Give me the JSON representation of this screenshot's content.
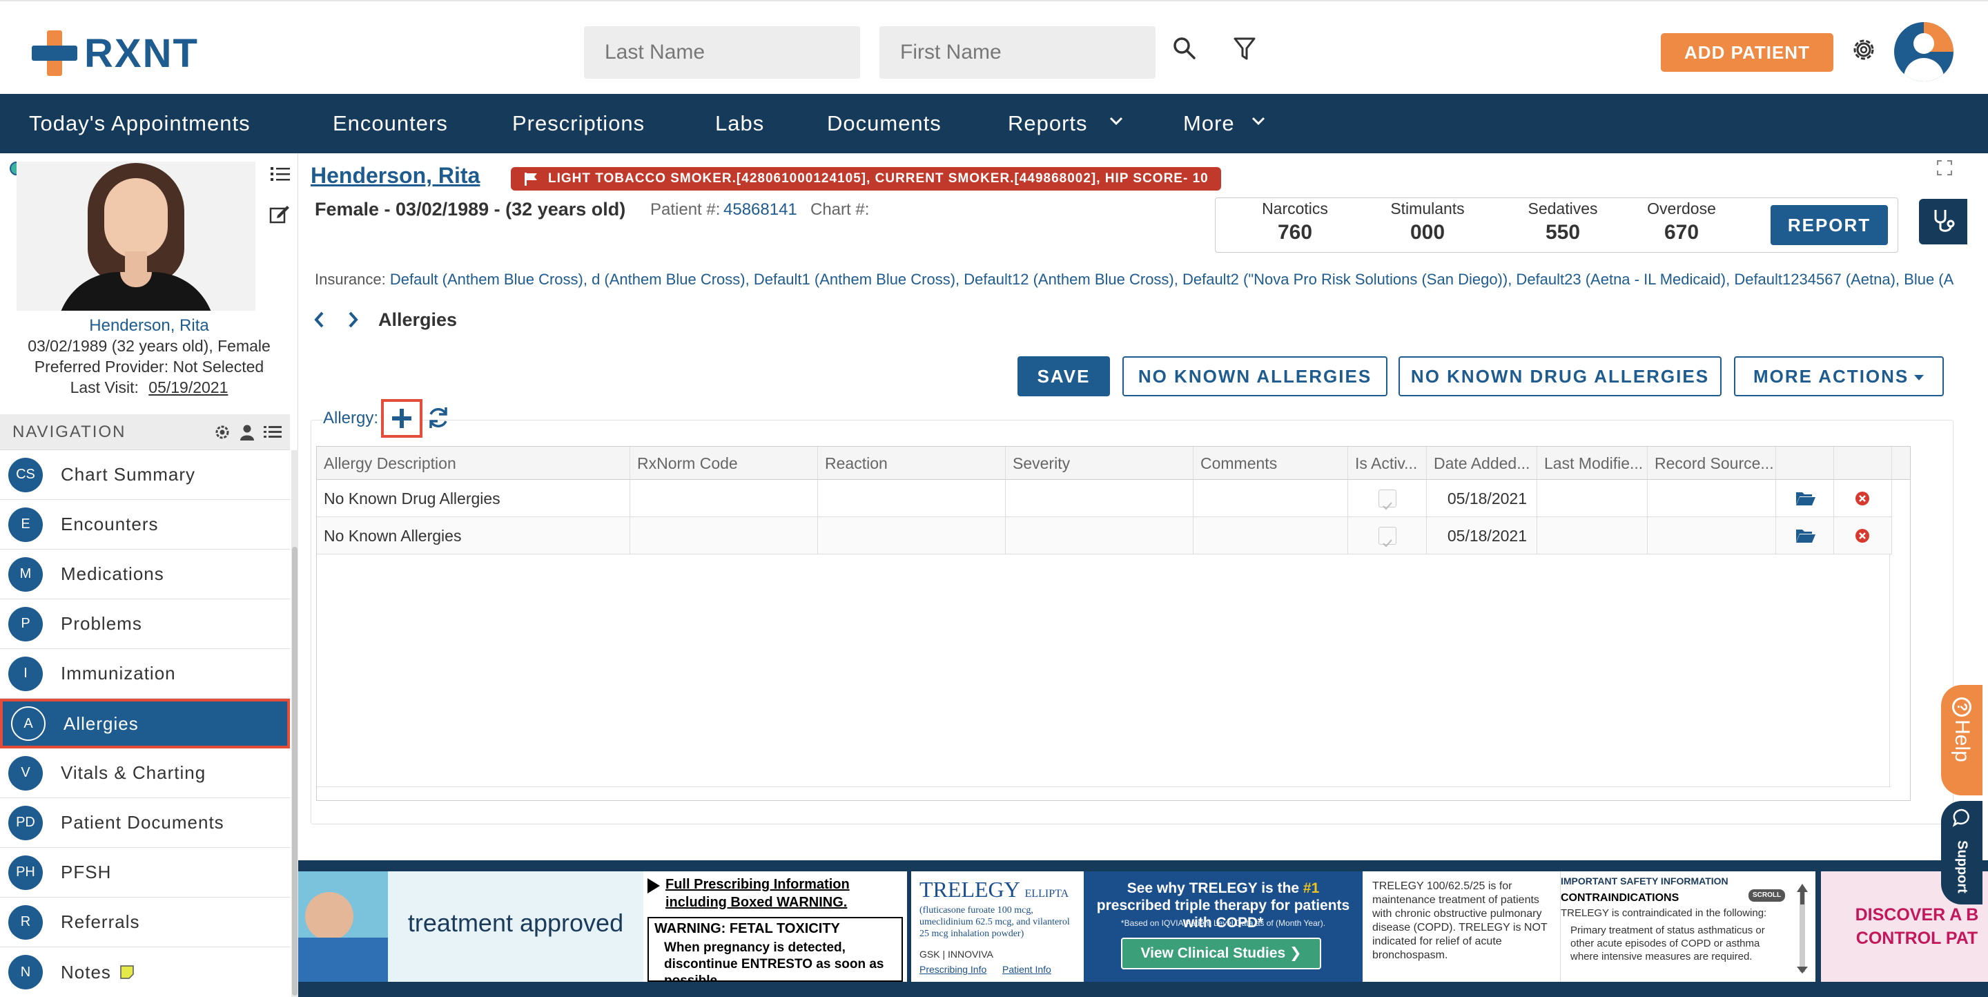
{
  "header": {
    "logo_text": "RXNT",
    "last_name_placeholder": "Last Name",
    "first_name_placeholder": "First Name",
    "add_patient_label": "ADD PATIENT"
  },
  "nav": {
    "items": [
      "Today's Appointments",
      "Encounters",
      "Prescriptions",
      "Labs",
      "Documents",
      "Reports",
      "More"
    ]
  },
  "patient": {
    "name": "Henderson, Rita",
    "dob_age_sex": "03/02/1989 (32 years old), Female",
    "preferred_provider": "Preferred Provider: Not Selected",
    "last_visit_label": "Last Visit:",
    "last_visit": "05/19/2021",
    "header_name": "Henderson, Rita",
    "alert": "LIGHT TOBACCO SMOKER.[428061000124105], CURRENT SMOKER.[449868002], HIP SCORE- 10",
    "demographics": "Female - 03/02/1989 - (32 years old)",
    "patient_num_label": "Patient #:",
    "patient_num": "45868141",
    "chart_num_label": "Chart #:",
    "insurance_label": "Insurance:",
    "insurance": "Default (Anthem Blue Cross), d (Anthem Blue Cross), Default1 (Anthem Blue Cross), Default12 (Anthem Blue Cross), Default2 (\"Nova Pro Risk Solutions (San Diego)), Default23 (Aetna - IL Medicaid), Default1234567 (Aetna), Blue (A"
  },
  "pdmp": {
    "stats": [
      {
        "label": "Narcotics",
        "value": "760"
      },
      {
        "label": "Stimulants",
        "value": "000"
      },
      {
        "label": "Sedatives",
        "value": "550"
      },
      {
        "label": "Overdose",
        "value": "670"
      }
    ],
    "report_label": "REPORT"
  },
  "sidebar": {
    "title": "NAVIGATION",
    "items": [
      {
        "abbr": "CS",
        "label": "Chart Summary"
      },
      {
        "abbr": "E",
        "label": "Encounters"
      },
      {
        "abbr": "M",
        "label": "Medications"
      },
      {
        "abbr": "P",
        "label": "Problems"
      },
      {
        "abbr": "I",
        "label": "Immunization"
      },
      {
        "abbr": "A",
        "label": "Allergies"
      },
      {
        "abbr": "V",
        "label": "Vitals & Charting"
      },
      {
        "abbr": "PD",
        "label": "Patient Documents"
      },
      {
        "abbr": "PH",
        "label": "PFSH"
      },
      {
        "abbr": "R",
        "label": "Referrals"
      },
      {
        "abbr": "N",
        "label": "Notes"
      }
    ]
  },
  "page": {
    "breadcrumb": "Allergies",
    "save_label": "SAVE",
    "nka_label": "NO KNOWN ALLERGIES",
    "nkda_label": "NO KNOWN DRUG ALLERGIES",
    "more_actions_label": "MORE ACTIONS",
    "allergy_label": "Allergy:"
  },
  "table": {
    "columns": [
      "Allergy Description",
      "RxNorm Code",
      "Reaction",
      "Severity",
      "Comments",
      "Is Activ...",
      "Date Added...",
      "Last Modifie...",
      "Record Source..."
    ],
    "rows": [
      {
        "description": "No Known Drug Allergies",
        "date_added": "05/18/2021"
      },
      {
        "description": "No Known Allergies",
        "date_added": "05/18/2021"
      }
    ]
  },
  "ads": {
    "ad1_text": "treatment approved",
    "ad1_link": "Full Prescribing Information including Boxed WARNING.",
    "ad1_warning_title": "WARNING: FETAL TOXICITY",
    "ad1_warning_text": "When pregnancy is detected, discontinue ENTRESTO as soon as possible",
    "ad2_brand": "TRELEGY",
    "ad2_brand_sub": "ELLIPTA",
    "ad2_ingredients": "(fluticasone furoate 100 mcg, umeclidinium 62.5 mcg, and vilanterol 25 mcg inhalation powder)",
    "ad2_company": "GSK | INNOVIVA",
    "ad2_link1": "Prescribing Info",
    "ad2_link2": "Patient Info",
    "ad2_headline_1": "See why TRELEGY is the",
    "ad2_headline_rank": "#1",
    "ad2_headline_2": "prescribed triple therapy for patients with COPD*",
    "ad2_foot": "*Based on IQVIA Patient Level Data as of (Month Year).",
    "ad2_button": "View Clinical Studies",
    "ad3_text": "TRELEGY 100/62.5/25 is for maintenance treatment of patients with chronic obstructive pulmonary disease (COPD). TRELEGY is NOT indicated for relief of acute bronchospasm.",
    "ad4_title": "IMPORTANT SAFETY INFORMATION",
    "ad4_scroll": "SCROLL",
    "ad4_sub": "CONTRAINDICATIONS",
    "ad4_text": "TRELEGY is contraindicated in the following:",
    "ad4_bullet": "Primary treatment of status asthmaticus or other acute episodes of COPD or asthma where intensive measures are required.",
    "ad5_text": "DISCOVER A B CONTROL PAT"
  },
  "help_label": "Help",
  "support_label": "Support"
}
